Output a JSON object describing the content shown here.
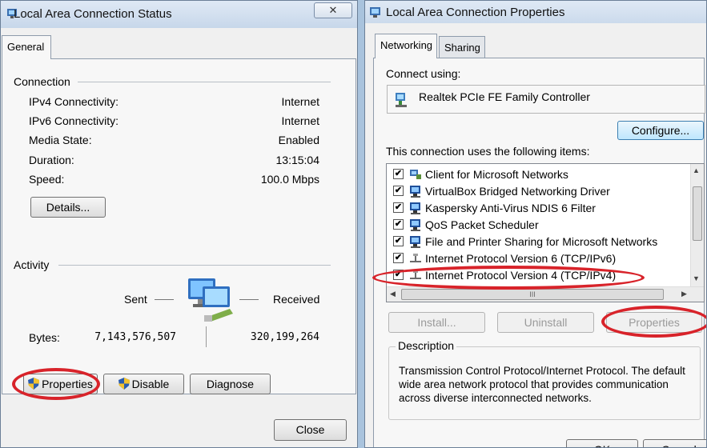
{
  "status_window": {
    "title": "Local Area Connection Status",
    "close_glyph": "✕",
    "tab": "General",
    "connection": {
      "heading": "Connection",
      "rows": [
        {
          "label": "IPv4 Connectivity:",
          "value": "Internet"
        },
        {
          "label": "IPv6 Connectivity:",
          "value": "Internet"
        },
        {
          "label": "Media State:",
          "value": "Enabled"
        },
        {
          "label": "Duration:",
          "value": "13:15:04"
        },
        {
          "label": "Speed:",
          "value": "100.0 Mbps"
        }
      ],
      "details_button": "Details..."
    },
    "activity": {
      "heading": "Activity",
      "sent_label": "Sent",
      "received_label": "Received",
      "bytes_label": "Bytes:",
      "bytes_sent": "7,143,576,507",
      "bytes_received": "320,199,264"
    },
    "buttons": {
      "properties": "Properties",
      "disable": "Disable",
      "diagnose": "Diagnose",
      "close": "Close"
    }
  },
  "properties_window": {
    "title": "Local Area Connection Properties",
    "tabs": [
      "Networking",
      "Sharing"
    ],
    "connect_using_label": "Connect using:",
    "adapter": "Realtek PCIe FE Family Controller",
    "configure_button": "Configure...",
    "items_label": "This connection uses the following items:",
    "items": [
      {
        "label": "Client for Microsoft Networks",
        "checked": true,
        "icon": "client-icon"
      },
      {
        "label": "VirtualBox Bridged Networking Driver",
        "checked": true,
        "icon": "network-service-icon"
      },
      {
        "label": "Kaspersky Anti-Virus NDIS 6 Filter",
        "checked": true,
        "icon": "network-service-icon"
      },
      {
        "label": "QoS Packet Scheduler",
        "checked": true,
        "icon": "network-service-icon"
      },
      {
        "label": "File and Printer Sharing for Microsoft Networks",
        "checked": true,
        "icon": "network-service-icon"
      },
      {
        "label": "Internet Protocol Version 6 (TCP/IPv6)",
        "checked": true,
        "icon": "protocol-icon"
      },
      {
        "label": "Internet Protocol Version 4 (TCP/IPv4)",
        "checked": true,
        "icon": "protocol-icon"
      }
    ],
    "buttons": {
      "install": "Install...",
      "uninstall": "Uninstall",
      "properties": "Properties"
    },
    "description": {
      "heading": "Description",
      "text": "Transmission Control Protocol/Internet Protocol. The default wide area network protocol that provides communication across diverse interconnected networks."
    },
    "ok_button": "OK",
    "cancel_button": "Cancel",
    "scrollbar_grip": "III"
  },
  "colors": {
    "highlight_circle": "#d8232a",
    "window_frame": "#c7d7ea"
  }
}
